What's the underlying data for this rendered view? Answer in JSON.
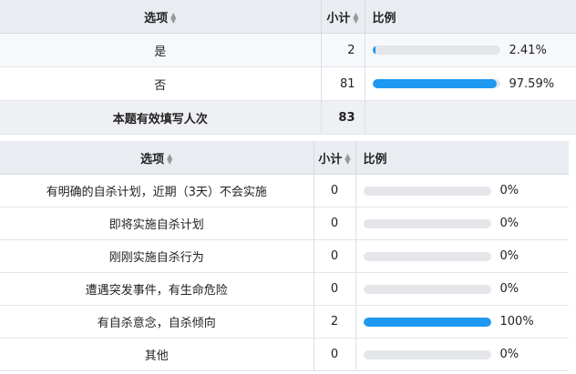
{
  "table1": {
    "header": {
      "option": "选项",
      "count": "小计",
      "ratio": "比例"
    },
    "rows": [
      {
        "option": "是",
        "count": "2",
        "percent": "2.41%",
        "fill": 0.0241
      },
      {
        "option": "否",
        "count": "81",
        "percent": "97.59%",
        "fill": 0.9759
      }
    ],
    "total": {
      "label": "本题有效填写人次",
      "count": "83"
    }
  },
  "table2": {
    "header": {
      "option": "选项",
      "count": "小计",
      "ratio": "比例"
    },
    "rows": [
      {
        "option": "有明确的自杀计划，近期（3天）不会实施",
        "count": "0",
        "percent": "0%",
        "fill": 0
      },
      {
        "option": "即将实施自杀计划",
        "count": "0",
        "percent": "0%",
        "fill": 0
      },
      {
        "option": "刚刚实施自杀行为",
        "count": "0",
        "percent": "0%",
        "fill": 0
      },
      {
        "option": "遭遇突发事件，有生命危险",
        "count": "0",
        "percent": "0%",
        "fill": 0
      },
      {
        "option": "有自杀意念，自杀倾向",
        "count": "2",
        "percent": "100%",
        "fill": 1
      },
      {
        "option": "其他",
        "count": "0",
        "percent": "0%",
        "fill": 0
      }
    ]
  },
  "colors": {
    "accent": "#1e98f0",
    "bar_track": "#e4e6ea",
    "header_bg": "#e9ecf0"
  },
  "icons": {
    "sort": "sort-arrows-icon"
  }
}
